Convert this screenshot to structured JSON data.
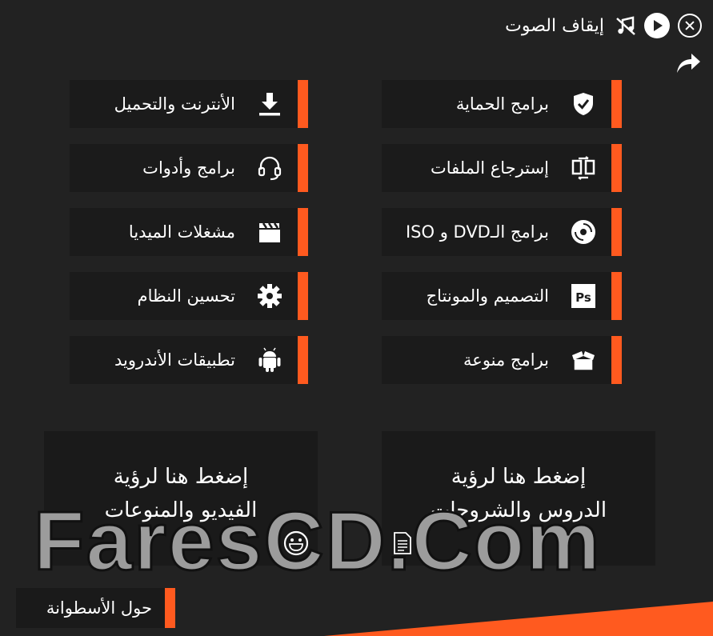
{
  "header": {
    "stop_sound_label": "إيقاف الصوت",
    "close_icon": "close-circle-icon",
    "play_icon": "play-circle-icon",
    "music_icon": "music-off-icon",
    "share_icon": "share-arrow-icon"
  },
  "accent_color": "#ff5a1f",
  "right_column": [
    {
      "label": "برامج الحماية",
      "icon": "shield-check-icon"
    },
    {
      "label": "إسترجاع الملفات",
      "icon": "file-recovery-icon"
    },
    {
      "label": "برامج الـDVD و ISO",
      "icon": "disc-icon"
    },
    {
      "label": "التصميم والمونتاج",
      "icon": "photoshop-icon"
    },
    {
      "label": "برامج منوعة",
      "icon": "open-box-icon"
    }
  ],
  "left_column": [
    {
      "label": "الأنترنت والتحميل",
      "icon": "download-icon"
    },
    {
      "label": "برامج وأدوات",
      "icon": "headset-icon"
    },
    {
      "label": "مشغلات الميديا",
      "icon": "clapperboard-icon"
    },
    {
      "label": "تحسين النظام",
      "icon": "gear-icon"
    },
    {
      "label": "تطبيقات الأندرويد",
      "icon": "android-icon"
    }
  ],
  "big_buttons": {
    "lessons": {
      "line1": "إضغط هنا لرؤية",
      "line2": "الدروس والشروحات",
      "icon": "document-icon"
    },
    "videos": {
      "line1": "إضغط هنا لرؤية",
      "line2": "الفيديو والمنوعات",
      "icon": "smiley-icon"
    }
  },
  "watermark": "FaresCD.Com",
  "about_label": "حول الأسطوانة"
}
